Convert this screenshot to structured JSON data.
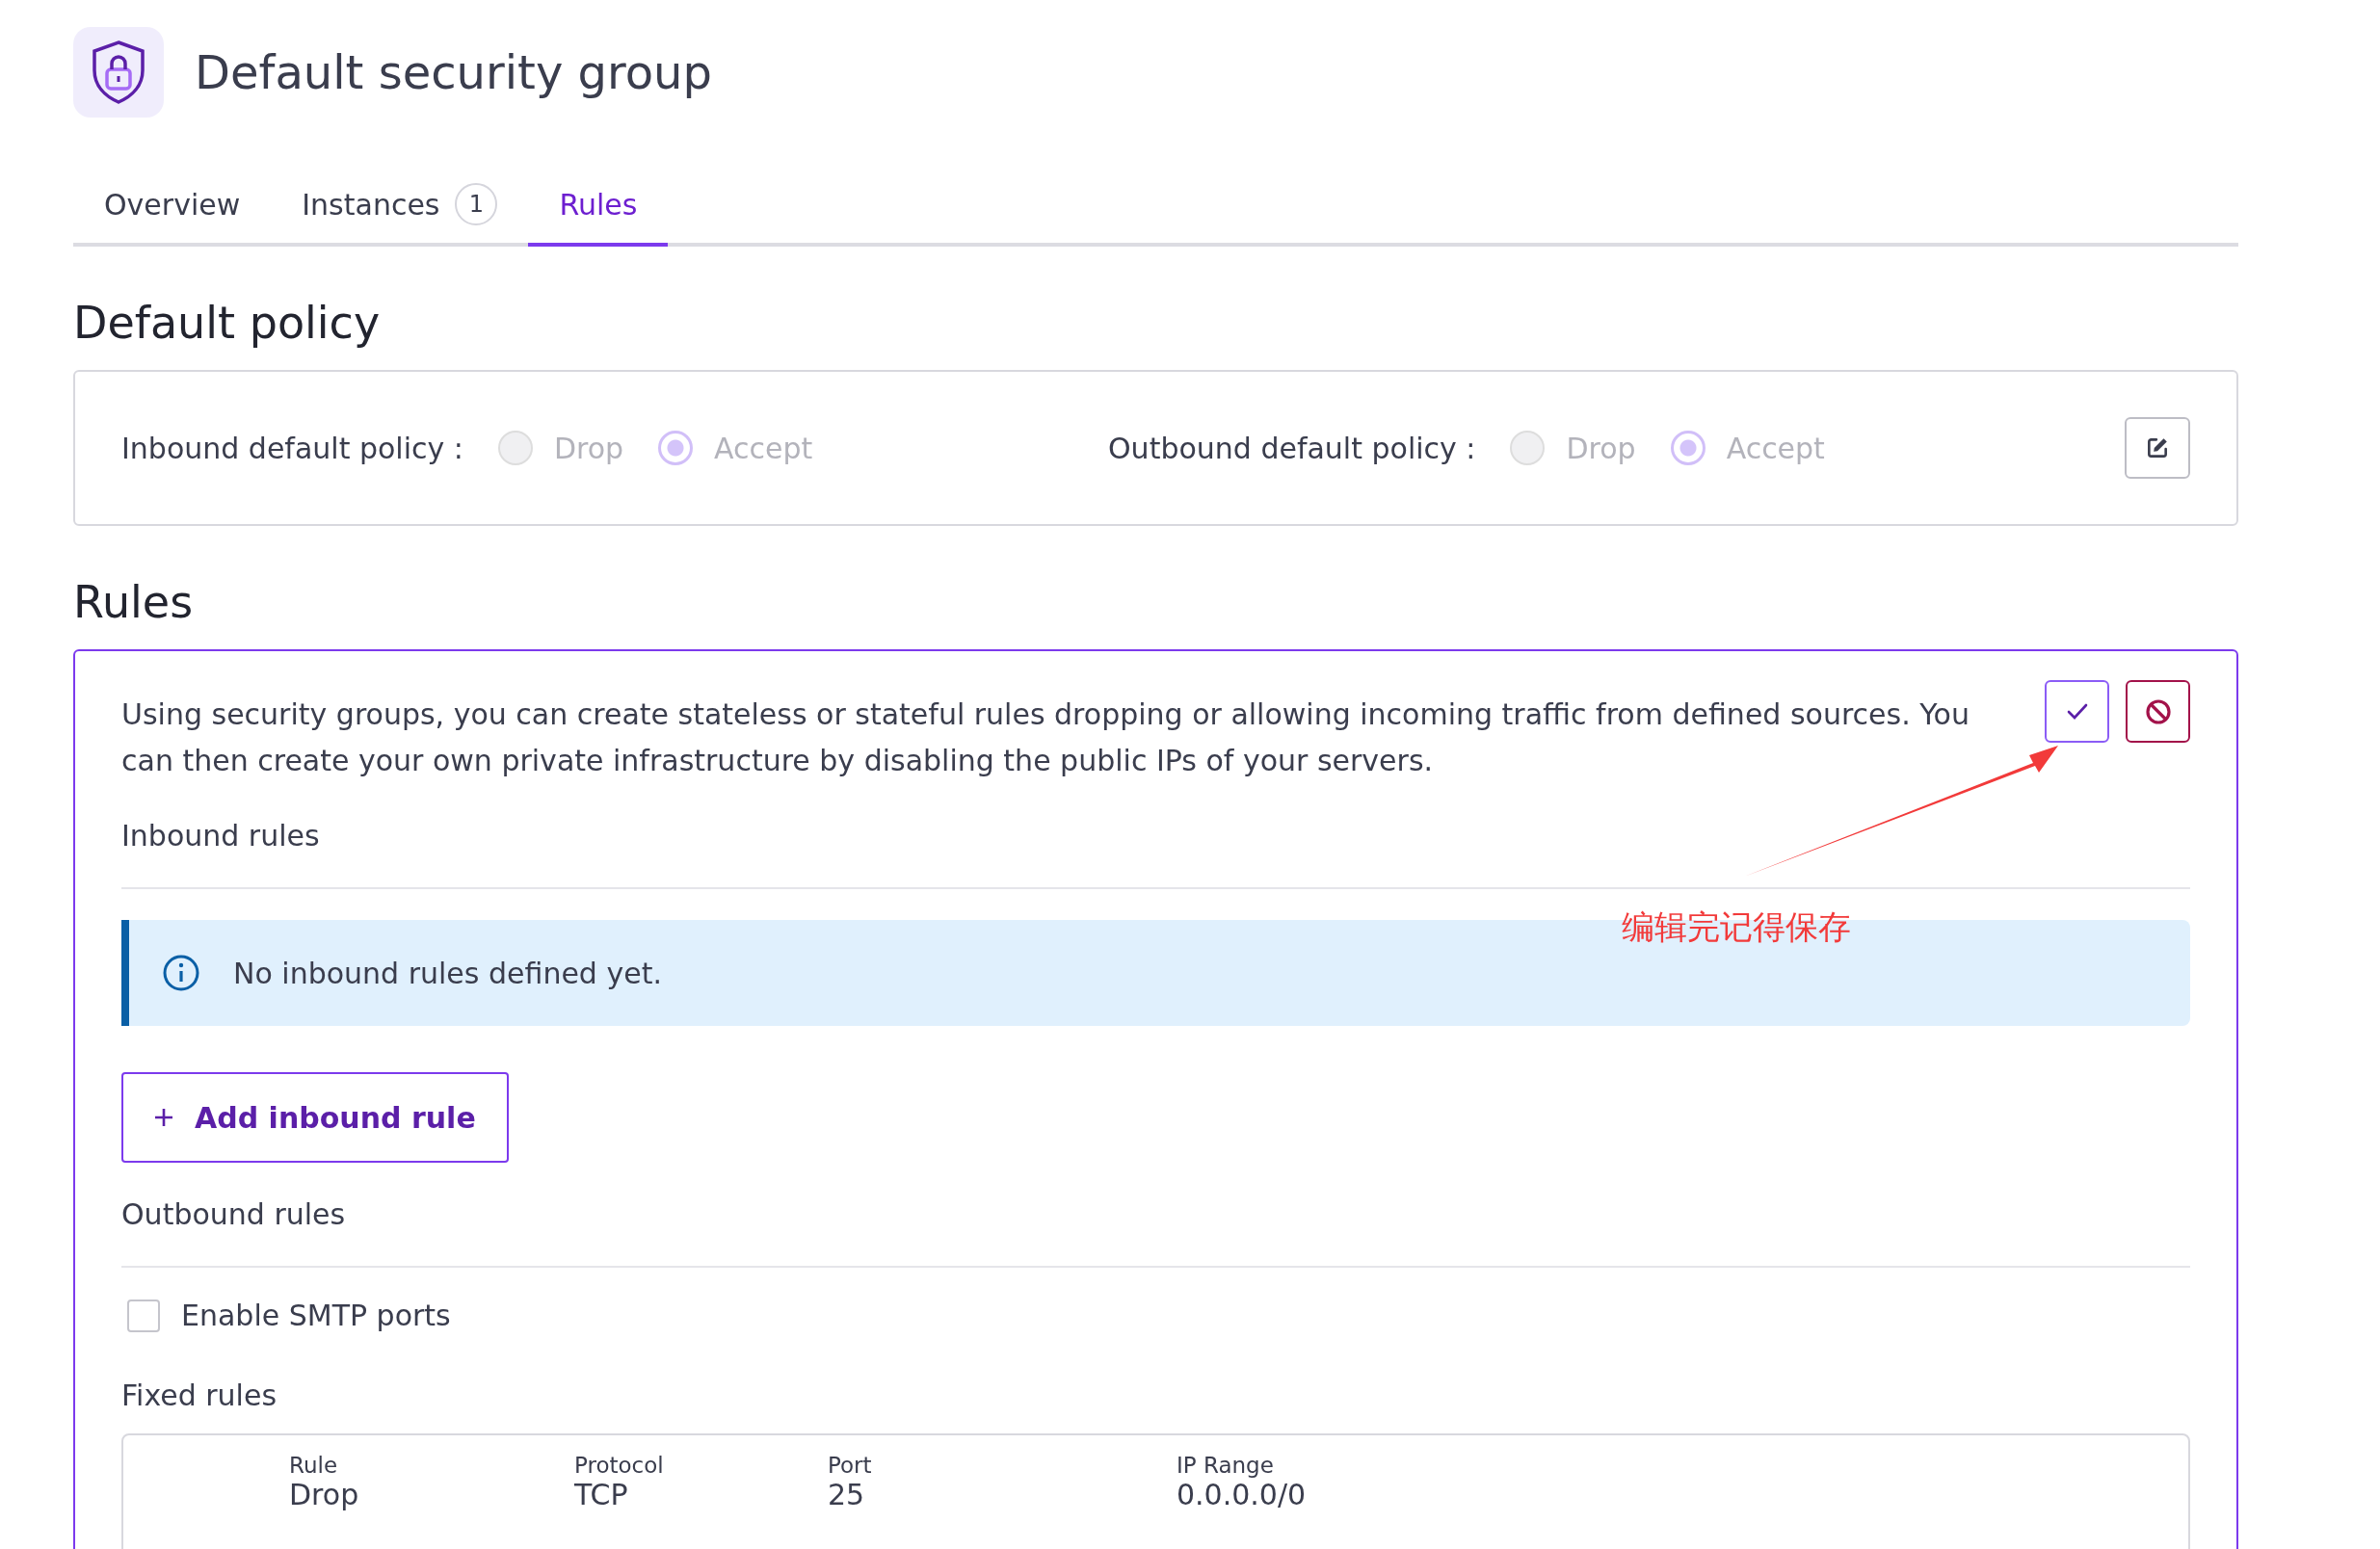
{
  "header": {
    "title": "Default security group"
  },
  "tabs": [
    {
      "label": "Overview",
      "selected": false
    },
    {
      "label": "Instances",
      "badge": "1",
      "selected": false
    },
    {
      "label": "Rules",
      "selected": true
    }
  ],
  "default_policy": {
    "heading": "Default policy",
    "disabled": true,
    "groups": [
      {
        "label": "Inbound default policy :",
        "options": [
          {
            "label": "Drop",
            "selected": false
          },
          {
            "label": "Accept",
            "selected": true
          }
        ]
      },
      {
        "label": "Outbound default policy :",
        "options": [
          {
            "label": "Drop",
            "selected": false
          },
          {
            "label": "Accept",
            "selected": true
          }
        ]
      }
    ]
  },
  "rules": {
    "heading": "Rules",
    "description": "Using security groups, you can create stateless or stateful rules dropping or allowing incoming traffic from defined sources. You can then create your own private infrastructure by disabling the public IPs of your servers.",
    "inbound_title": "Inbound rules",
    "info": "No inbound rules defined yet.",
    "add_button": "Add inbound rule",
    "outbound_title": "Outbound rules",
    "smtp": {
      "label": "Enable SMTP ports",
      "checked": false
    },
    "fixed_title": "Fixed rules",
    "table": {
      "columns": [
        "Rule",
        "Protocol",
        "Port",
        "IP Range"
      ],
      "rows": [
        [
          "Drop",
          "TCP",
          "25",
          "0.0.0.0/0"
        ]
      ]
    }
  },
  "annotation": {
    "text": "编辑完记得保存"
  }
}
